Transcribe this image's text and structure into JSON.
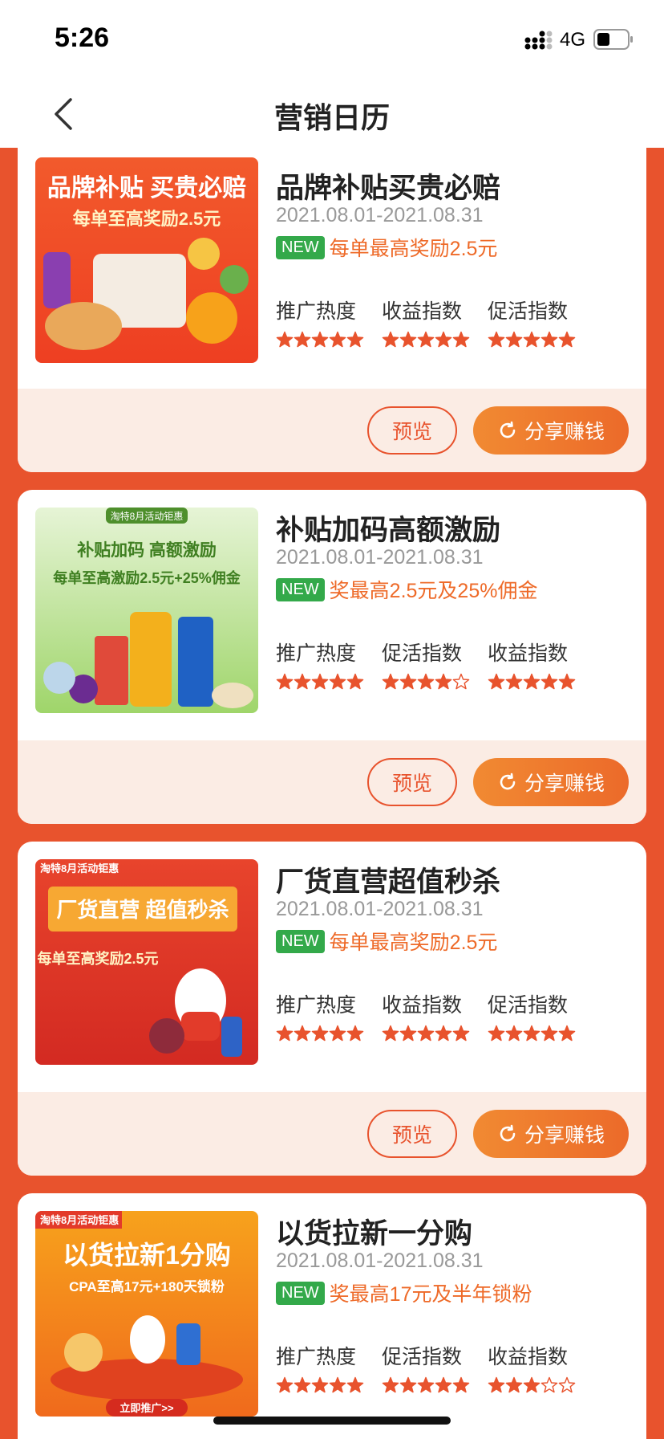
{
  "status": {
    "time": "5:26",
    "network": "4G"
  },
  "nav": {
    "title": "营销日历"
  },
  "buttons": {
    "preview": "预览",
    "share": "分享赚钱"
  },
  "colors": {
    "accent": "#e8532d",
    "new_badge": "#33a94a",
    "reward": "#ee6a28"
  },
  "cards": [
    {
      "title": "品牌补贴买贵必赔",
      "date": "2021.08.01-2021.08.31",
      "badge": "NEW",
      "reward": "每单最高奖励2.5元",
      "image": {
        "tag": "",
        "headline": "品牌补贴 买贵必赔",
        "subline": "每单至高奖励2.5元"
      },
      "metrics": [
        {
          "label": "推广热度",
          "stars": 5
        },
        {
          "label": "收益指数",
          "stars": 5
        },
        {
          "label": "促活指数",
          "stars": 5
        }
      ]
    },
    {
      "title": "补贴加码高额激励",
      "date": "2021.08.01-2021.08.31",
      "badge": "NEW",
      "reward": "奖最高2.5元及25%佣金",
      "image": {
        "tag": "淘特8月活动钜惠",
        "headline": "补贴加码 高额激励",
        "subline": "每单至高激励2.5元+25%佣金"
      },
      "metrics": [
        {
          "label": "推广热度",
          "stars": 5
        },
        {
          "label": "促活指数",
          "stars": 4
        },
        {
          "label": "收益指数",
          "stars": 5
        }
      ]
    },
    {
      "title": "厂货直营超值秒杀",
      "date": "2021.08.01-2021.08.31",
      "badge": "NEW",
      "reward": "每单最高奖励2.5元",
      "image": {
        "tag": "淘特8月活动钜惠",
        "headline": "厂货直营 超值秒杀",
        "subline": "每单至高奖励2.5元"
      },
      "metrics": [
        {
          "label": "推广热度",
          "stars": 5
        },
        {
          "label": "收益指数",
          "stars": 5
        },
        {
          "label": "促活指数",
          "stars": 5
        }
      ]
    },
    {
      "title": "以货拉新一分购",
      "date": "2021.08.01-2021.08.31",
      "badge": "NEW",
      "reward": "奖最高17元及半年锁粉",
      "image": {
        "tag": "淘特8月活动钜惠",
        "headline": "以货拉新1分购",
        "subline": "CPA至高17元+180天锁粉",
        "cta": "立即推广>>"
      },
      "metrics": [
        {
          "label": "推广热度",
          "stars": 5
        },
        {
          "label": "促活指数",
          "stars": 5
        },
        {
          "label": "收益指数",
          "stars": 3
        }
      ]
    }
  ]
}
